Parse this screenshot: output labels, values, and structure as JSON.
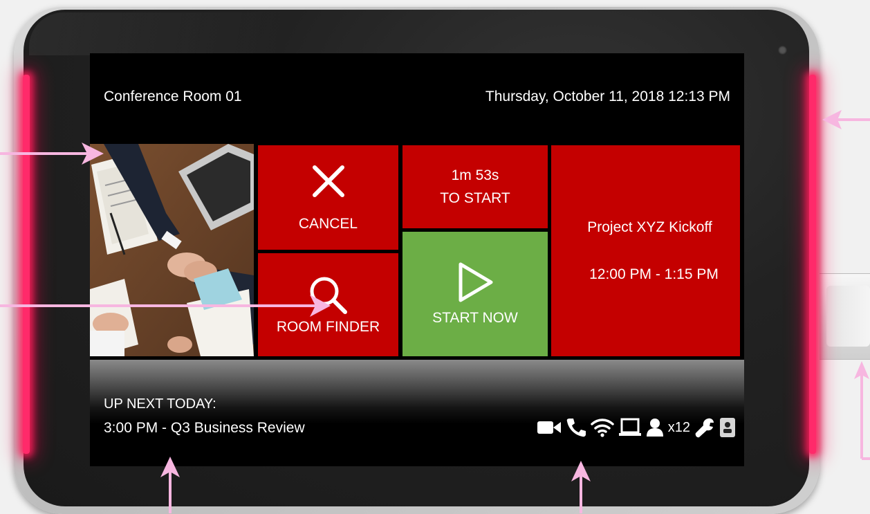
{
  "room_name": "Conference Room 01",
  "datetime": "Thursday, October 11, 2018 12:13 PM",
  "tiles": {
    "cancel": {
      "label": "CANCEL",
      "icon": "close-icon"
    },
    "room_finder": {
      "label": "ROOM FINDER",
      "icon": "search-icon"
    },
    "countdown": {
      "time": "1m 53s",
      "label": "TO START"
    },
    "start_now": {
      "label": "START NOW",
      "icon": "play-icon"
    },
    "meeting": {
      "title": "Project XYZ Kickoff",
      "time": "12:00 PM - 1:15 PM"
    }
  },
  "up_next": {
    "label": "UP NEXT TODAY:",
    "item": "3:00 PM - Q3 Business Review"
  },
  "status_icons": [
    "video-icon",
    "phone-icon",
    "wifi-icon",
    "display-icon",
    "person-icon",
    "wrench-icon",
    "badge-icon"
  ],
  "capacity": "x12",
  "colors": {
    "tile_red": "#c40000",
    "tile_green": "#6cae46",
    "led": "#ff2a6a",
    "annotation_arrow": "#f7b6e0"
  }
}
